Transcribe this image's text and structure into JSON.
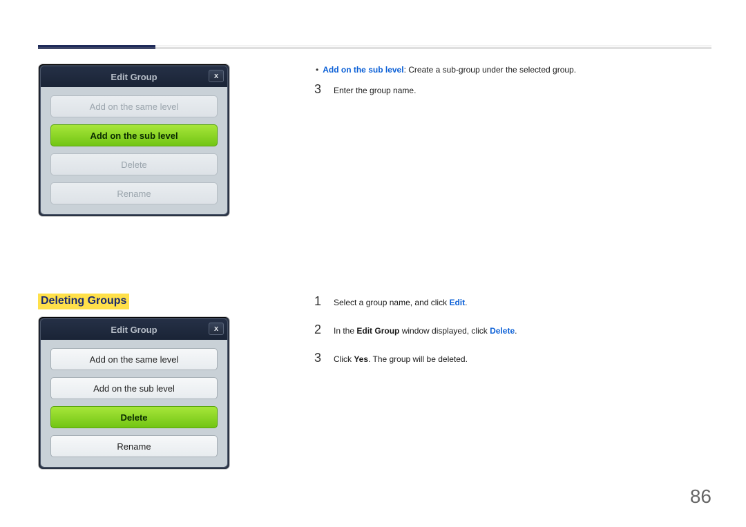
{
  "page_number": "86",
  "dialog1": {
    "title": "Edit Group",
    "close": "x",
    "buttons": {
      "same": "Add on the same level",
      "sub": "Add on the sub level",
      "delete": "Delete",
      "rename": "Rename"
    }
  },
  "section_heading": "Deleting Groups",
  "dialog2": {
    "title": "Edit Group",
    "close": "x",
    "buttons": {
      "same": "Add on the same level",
      "sub": "Add on the sub level",
      "delete": "Delete",
      "rename": "Rename"
    }
  },
  "right_top": {
    "bullet_label": "Add on the sub level",
    "bullet_rest": ": Create a sub-group under the selected group.",
    "step3_num": "3",
    "step3_text": "Enter the group name."
  },
  "right_bottom": {
    "s1_num": "1",
    "s1_a": "Select a group name, and click ",
    "s1_b": "Edit",
    "s1_c": ".",
    "s2_num": "2",
    "s2_a": "In the ",
    "s2_b": "Edit Group",
    "s2_c": " window displayed, click ",
    "s2_d": "Delete",
    "s2_e": ".",
    "s3_num": "3",
    "s3_a": "Click ",
    "s3_b": "Yes",
    "s3_c": ". The group will be deleted."
  }
}
